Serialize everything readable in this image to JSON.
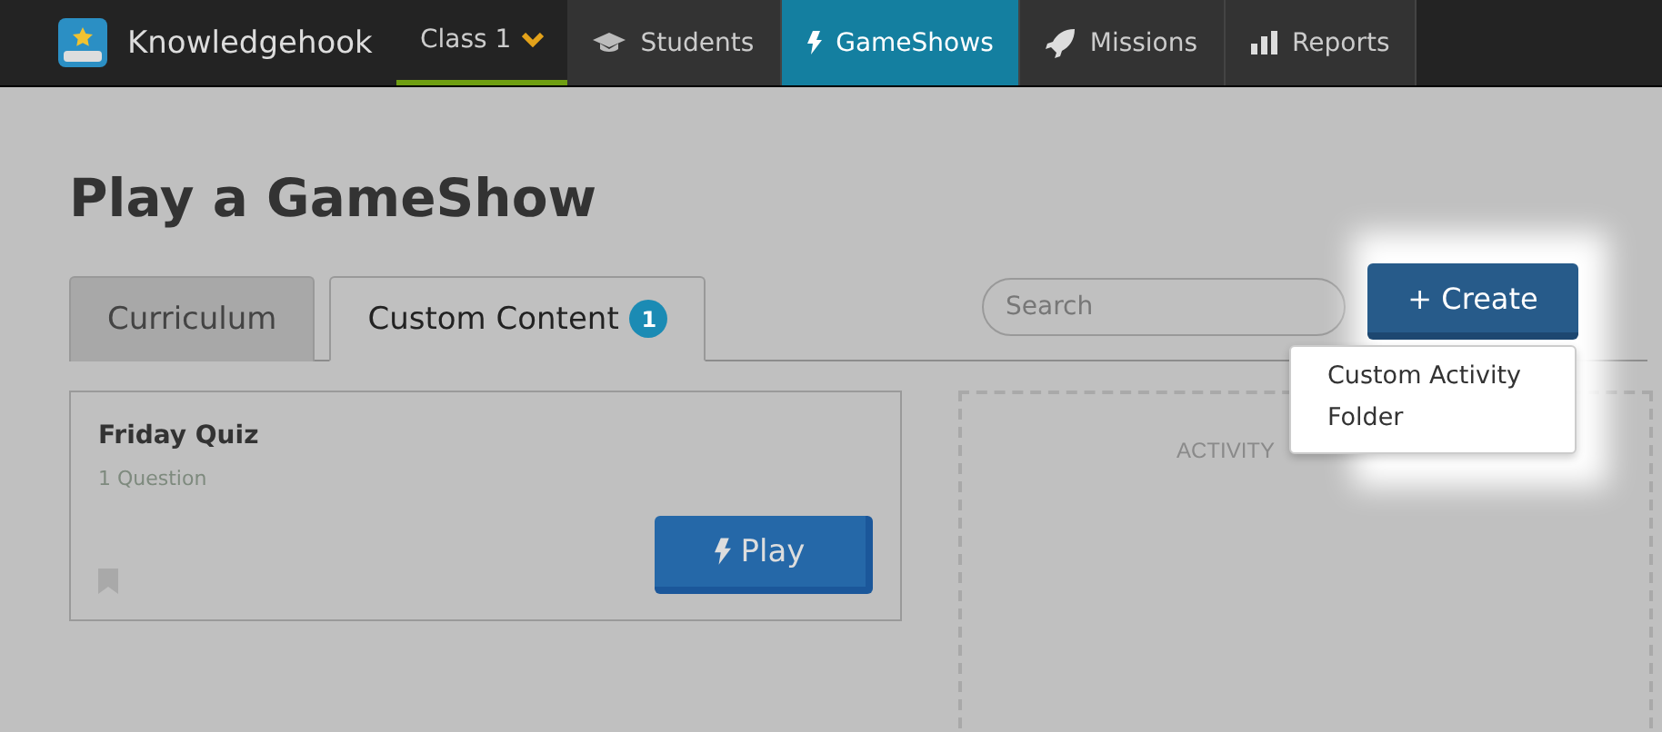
{
  "navbar": {
    "brand": "Knowledgehook",
    "class_selector": {
      "label": "Class 1",
      "selected": true
    },
    "items": [
      {
        "kind": "students",
        "label": "Students",
        "selected": false
      },
      {
        "kind": "gameshows",
        "label": "GameShows",
        "selected": true
      },
      {
        "kind": "missions",
        "label": "Missions",
        "selected": false
      },
      {
        "kind": "reports",
        "label": "Reports",
        "selected": false
      }
    ]
  },
  "page": {
    "title": "Play a GameShow",
    "tabs": [
      {
        "label": "Curriculum",
        "selected": false
      },
      {
        "label": "Custom Content",
        "selected": true,
        "badge": "1"
      }
    ],
    "search": {
      "placeholder": "Search"
    },
    "create_button": {
      "label": "+ Create"
    },
    "create_menu": [
      {
        "label": "Custom Activity"
      },
      {
        "label": "Folder"
      }
    ],
    "cards": [
      {
        "title": "Friday Quiz",
        "subtitle": "1 Question",
        "play_label": "Play"
      }
    ],
    "dropzone": {
      "label": "ACTIVITY"
    }
  }
}
